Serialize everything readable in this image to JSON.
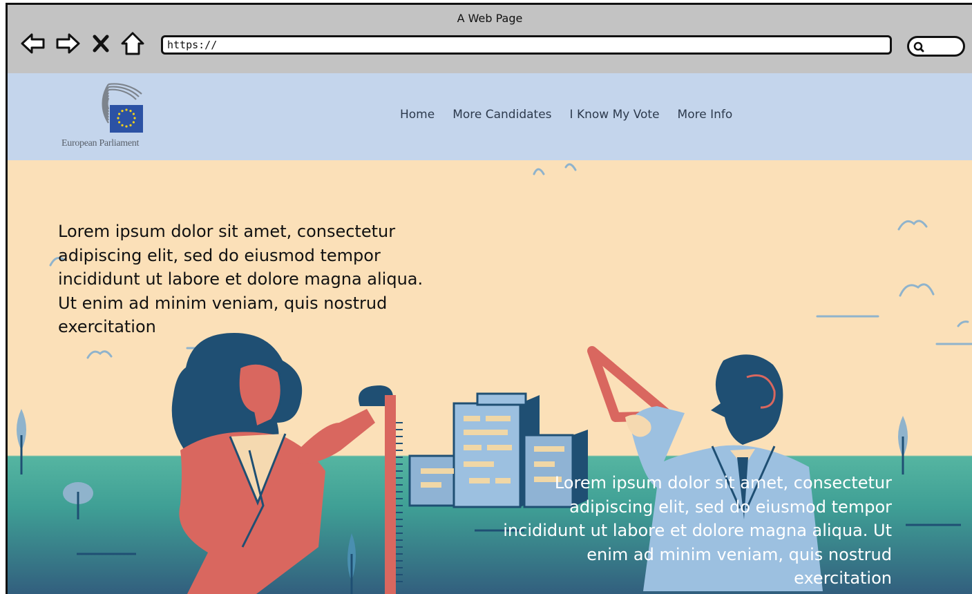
{
  "browser": {
    "window_title": "A Web Page",
    "url": "https://",
    "buttons": {
      "back_icon": "left-arrow-icon",
      "forward_icon": "right-arrow-icon",
      "stop_icon": "close-x-icon",
      "home_icon": "home-icon",
      "search_icon": "search-icon"
    }
  },
  "header": {
    "logo_caption": "European Parliament",
    "nav": [
      {
        "label": "Home"
      },
      {
        "label": "More Candidates"
      },
      {
        "label": "I Know My Vote"
      },
      {
        "label": "More Info"
      }
    ]
  },
  "hero": {
    "text_left": "Lorem ipsum dolor sit amet, consectetur adipiscing elit, sed do eiusmod tempor incididunt ut labore et dolore magna aliqua. Ut enim ad minim veniam, quis nostrud exercitation",
    "text_right": "Lorem ipsum dolor sit amet, consectetur adipiscing elit, sed do eiusmod tempor incididunt ut labore et dolore magna aliqua. Ut enim ad minim veniam, quis nostrud exercitation"
  },
  "colors": {
    "chrome": "#c3c3c3",
    "header": "#c4d5ec",
    "sky": "#fbe0b8",
    "ground": "#55b5a1",
    "navy": "#1f4f73",
    "coral": "#d9675f"
  }
}
